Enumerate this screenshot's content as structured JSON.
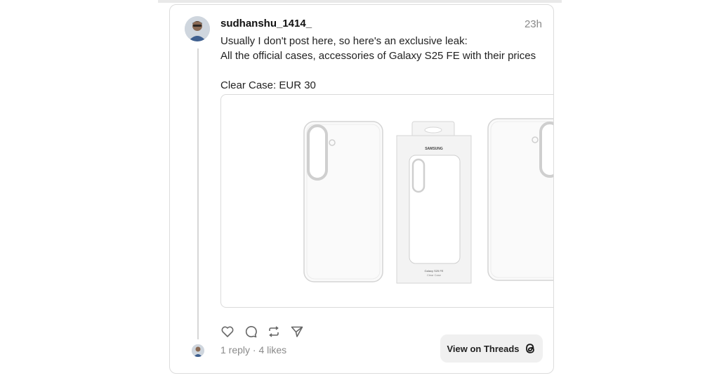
{
  "post": {
    "username": "sudhanshu_1414_",
    "time": "23h",
    "text_lines": [
      "Usually I don't post here, so here's an exclusive leak:",
      "All the official cases, accessories of Galaxy S25 FE with their prices",
      "",
      "Clear Case: EUR 30"
    ],
    "image": {
      "box_brand": "SAMSUNG",
      "box_model": "Galaxy S25 FE",
      "box_product": "Clear Case"
    },
    "actions": {
      "like_icon": "heart-icon",
      "reply_icon": "comment-icon",
      "repost_icon": "repost-icon",
      "share_icon": "send-icon"
    },
    "replies": "1 reply",
    "separator": " · ",
    "likes": "4 likes",
    "view_button_label": "View on Threads",
    "view_button_icon": "threads-logo-icon"
  },
  "colors": {
    "muted_text": "#8a8a8a",
    "border": "#dcdcdc",
    "button_bg": "#f0f0f0"
  }
}
